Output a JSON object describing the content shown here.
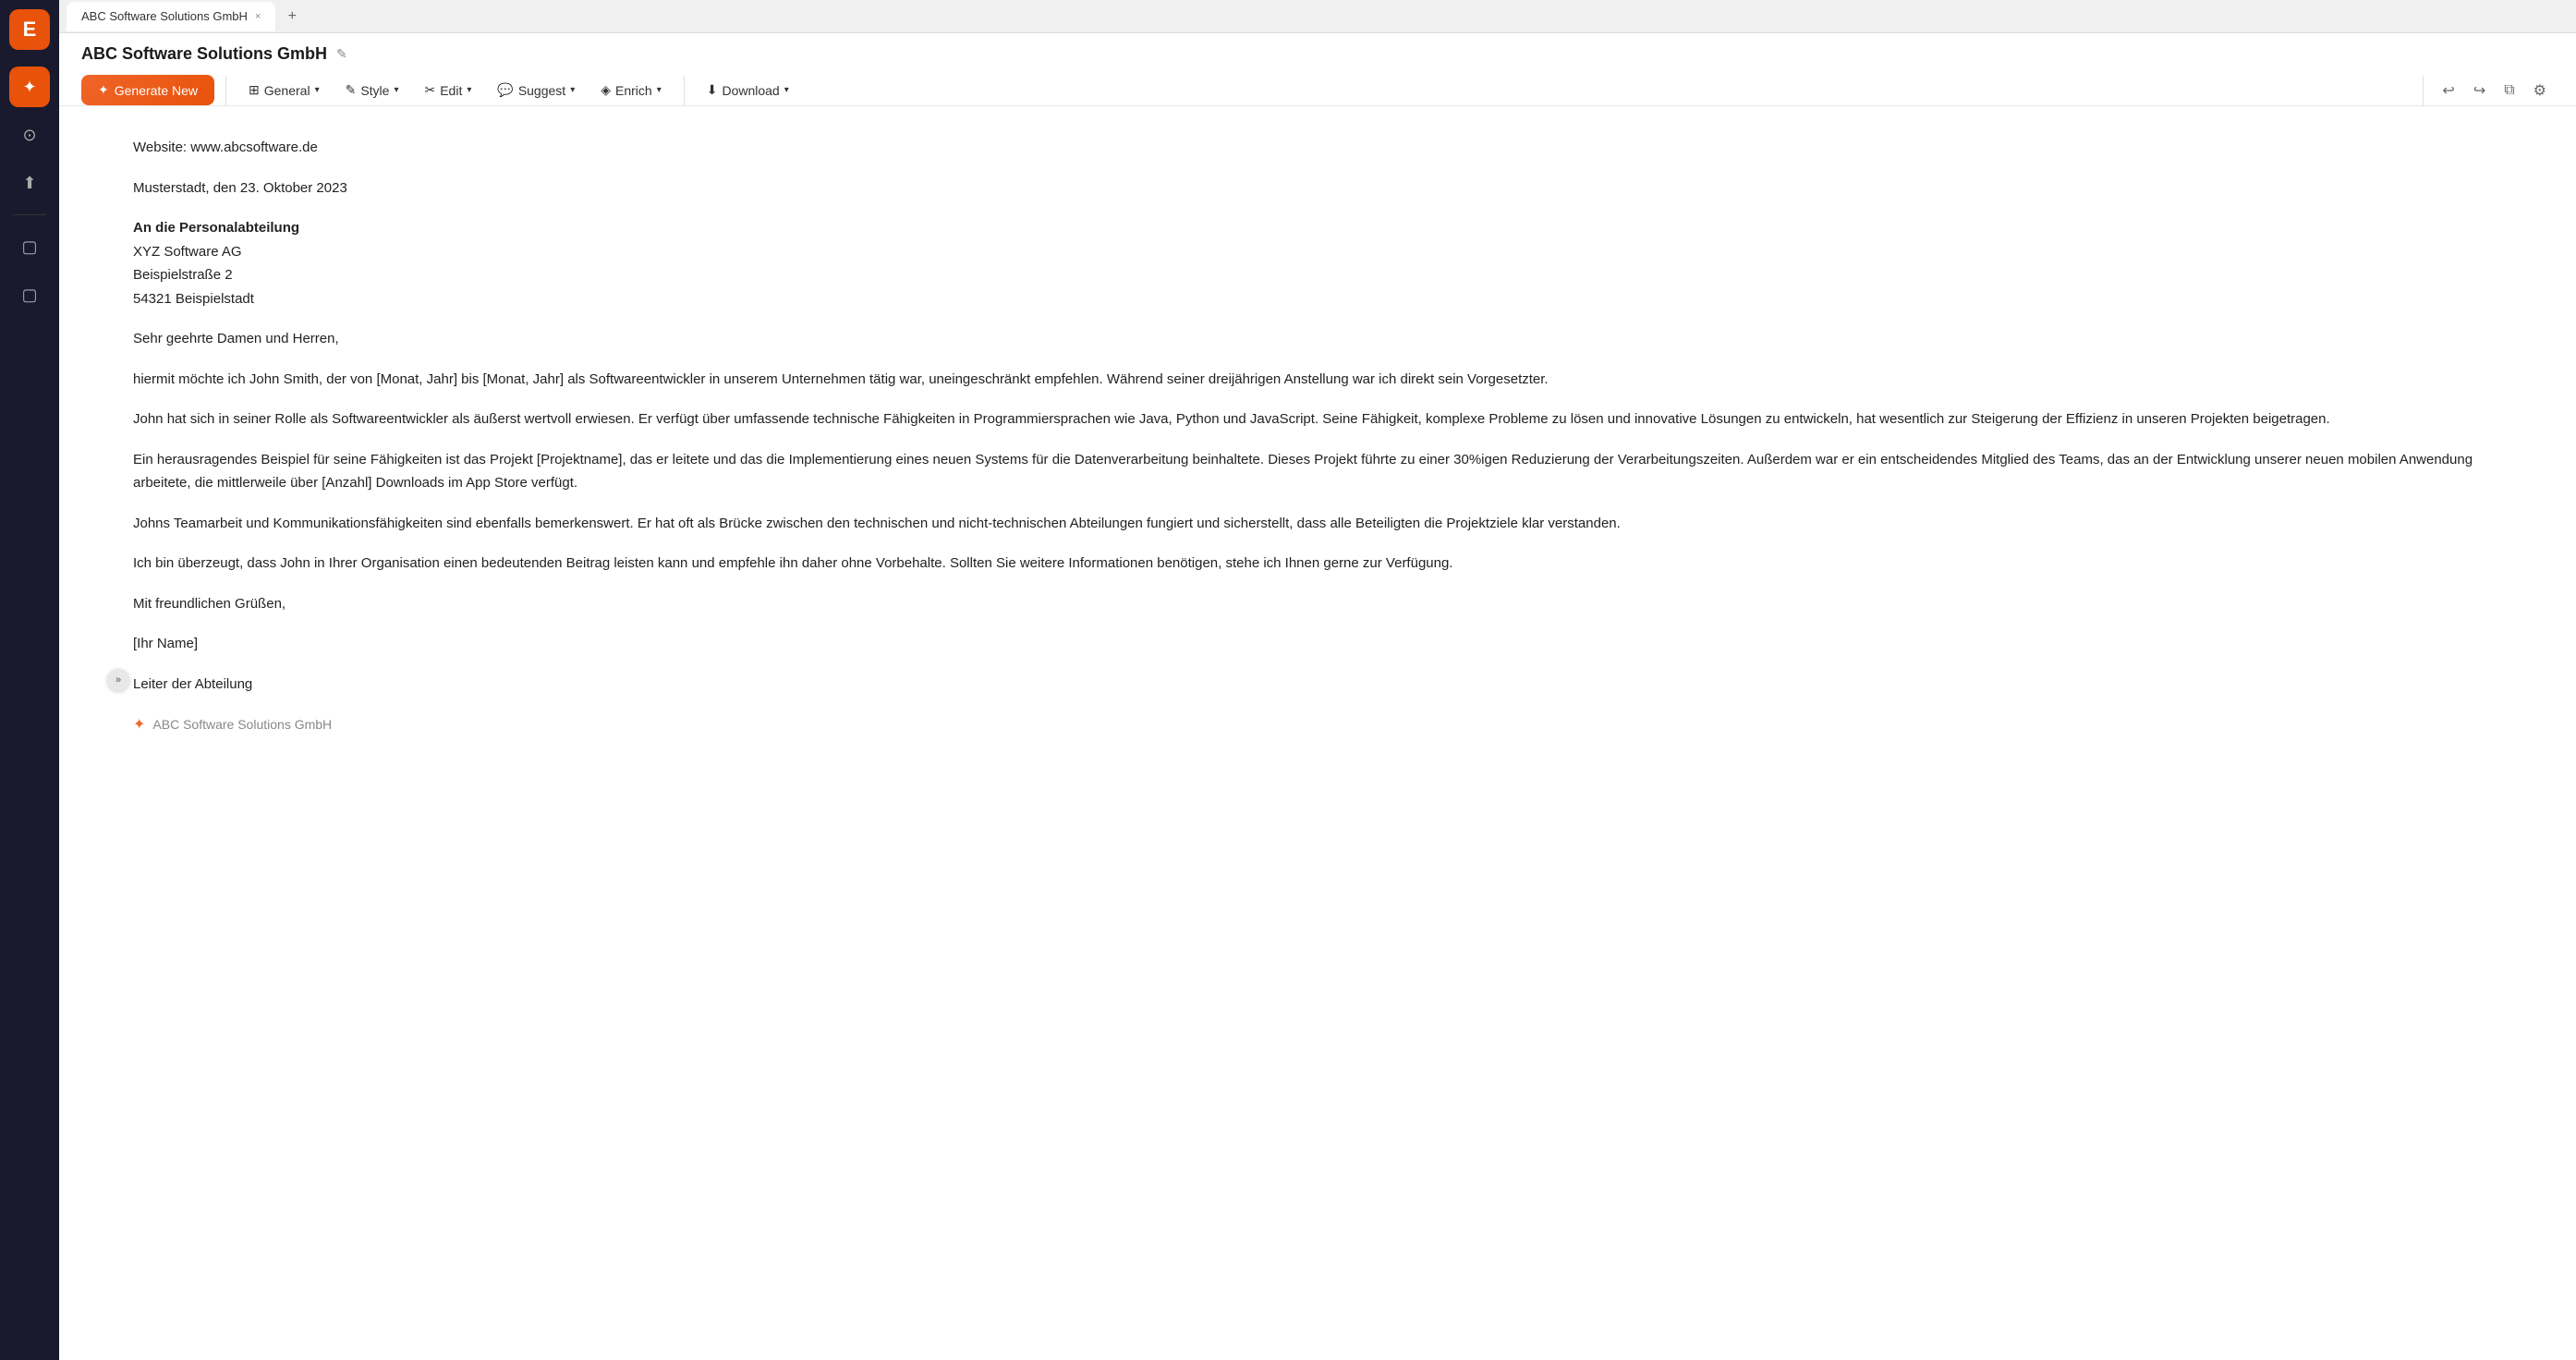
{
  "browser": {
    "tab_label": "ABC Software Solutions GmbH",
    "tab_close": "×",
    "tab_add": "+"
  },
  "sidebar": {
    "logo_icon": "E",
    "buttons": [
      {
        "id": "star",
        "icon": "✦",
        "label": "ai-button"
      },
      {
        "id": "bookmark",
        "icon": "🔖",
        "label": "saved-button"
      },
      {
        "id": "upload",
        "icon": "⬆",
        "label": "upload-button"
      },
      {
        "id": "folder1",
        "icon": "📁",
        "label": "folder1-button"
      },
      {
        "id": "folder2",
        "icon": "📁",
        "label": "folder2-button"
      }
    ],
    "collapse_icon": "»"
  },
  "header": {
    "doc_title": "ABC Software Solutions GmbH",
    "edit_icon": "✎",
    "toolbar": {
      "generate_label": "Generate New",
      "generate_icon": "✦",
      "general_label": "General",
      "style_label": "Style",
      "edit_label": "Edit",
      "suggest_label": "Suggest",
      "enrich_label": "Enrich",
      "download_label": "Download",
      "undo_icon": "↩",
      "redo_icon": "↪",
      "copy_icon": "⧉",
      "settings_icon": "⚙"
    }
  },
  "document": {
    "website_line": "Website: www.abcsoftware.de",
    "date_line": "Musterstadt, den 23. Oktober 2023",
    "recipient_heading": "An die Personalabteilung",
    "recipient_company": "XYZ Software AG",
    "recipient_street": "Beispielstraße 2",
    "recipient_city": "54321 Beispielstadt",
    "salutation": "Sehr geehrte Damen und Herren,",
    "para1": "hiermit möchte ich John Smith, der von [Monat, Jahr] bis [Monat, Jahr] als Softwareentwickler in unserem Unternehmen tätig war, uneingeschränkt empfehlen. Während seiner dreijährigen Anstellung war ich direkt sein Vorgesetzter.",
    "para2": "John hat sich in seiner Rolle als Softwareentwickler als äußerst wertvoll erwiesen. Er verfügt über umfassende technische Fähigkeiten in Programmiersprachen wie Java, Python und JavaScript. Seine Fähigkeit, komplexe Probleme zu lösen und innovative Lösungen zu entwickeln, hat wesentlich zur Steigerung der Effizienz in unseren Projekten beigetragen.",
    "para3": "Ein herausragendes Beispiel für seine Fähigkeiten ist das Projekt [Projektname], das er leitete und das die Implementierung eines neuen Systems für die Datenverarbeitung beinhaltete. Dieses Projekt führte zu einer 30%igen Reduzierung der Verarbeitungszeiten. Außerdem war er ein entscheidendes Mitglied des Teams, das an der Entwicklung unserer neuen mobilen Anwendung arbeitete, die mittlerweile über [Anzahl] Downloads im App Store verfügt.",
    "para4": "Johns Teamarbeit und Kommunikationsfähigkeiten sind ebenfalls bemerkenswert. Er hat oft als Brücke zwischen den technischen und nicht-technischen Abteilungen fungiert und sicherstellt, dass alle Beteiligten die Projektziele klar verstanden.",
    "para5": "Ich bin überzeugt, dass John in Ihrer Organisation einen bedeutenden Beitrag leisten kann und empfehle ihn daher ohne Vorbehalte. Sollten Sie weitere Informationen benötigen, stehe ich Ihnen gerne zur Verfügung.",
    "closing": "Mit freundlichen Grüßen,",
    "name_placeholder": "[Ihr Name]",
    "title": "Leiter der Abteilung",
    "footer_company": "ABC Software Solutions GmbH",
    "footer_icon": "✦"
  }
}
